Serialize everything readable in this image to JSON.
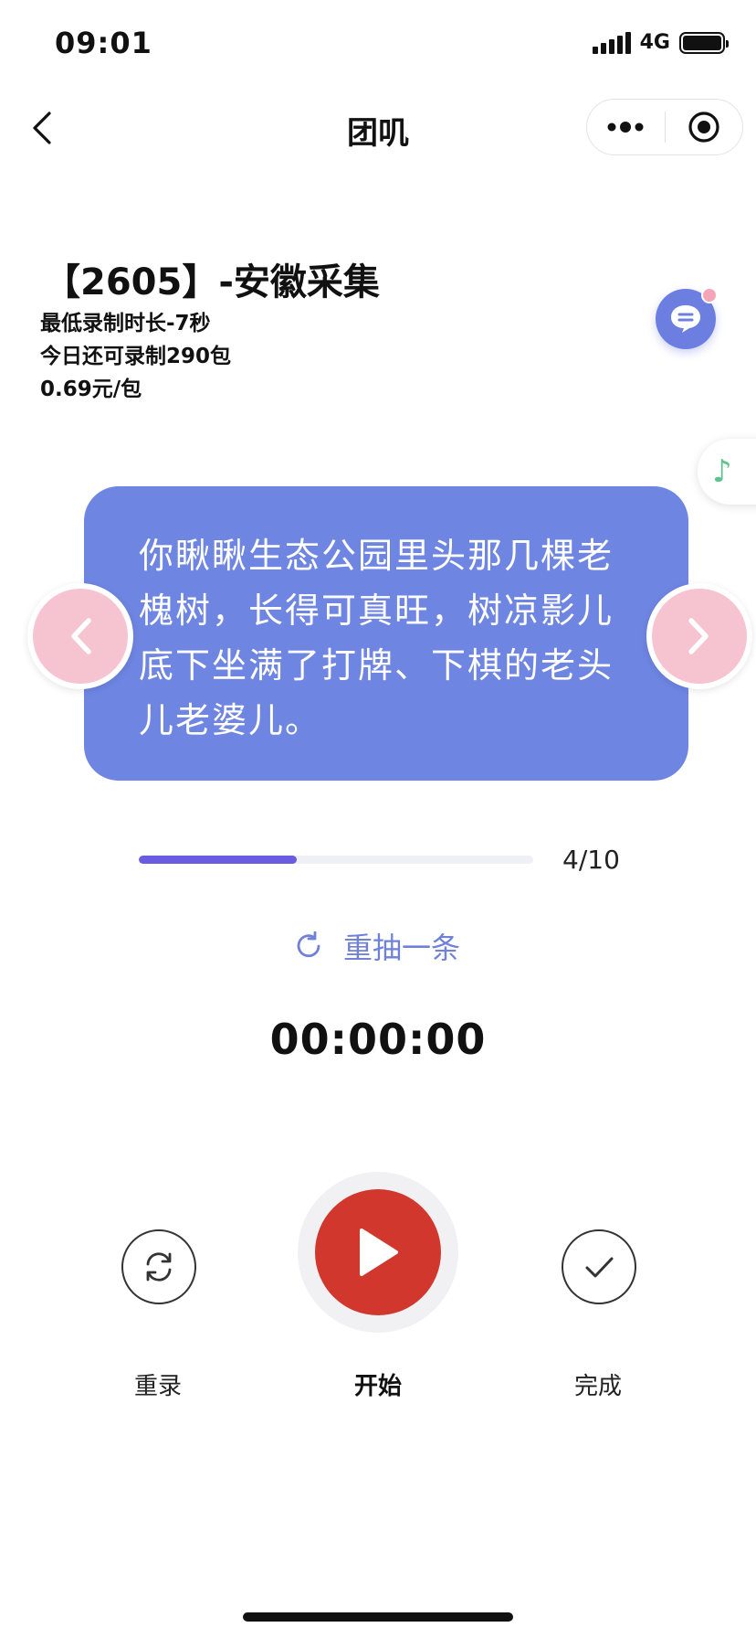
{
  "status_bar": {
    "time": "09:01",
    "network": "4G"
  },
  "nav": {
    "title": "团叽",
    "back_icon": "chevron-left-icon",
    "more_icon": "more-dots-icon",
    "close_icon": "target-circle-icon"
  },
  "task": {
    "title": "【2605】-安徽采集",
    "min_duration": "最低录制时长-7秒",
    "remaining_today": "今日还可录制290包",
    "price": "0.69元/包"
  },
  "floating": {
    "chat_icon": "chat-bubble-icon",
    "music_icon": "music-note-icon",
    "chat_color": "#6c7fe0",
    "music_color": "#5cc48a"
  },
  "prompt": {
    "text": "你瞅瞅生态公园里头那几棵老槐树，长得可真旺，树凉影儿底下坐满了打牌、下棋的老头儿老婆儿。",
    "card_color": "#6e85e2"
  },
  "progress": {
    "label": "4/10",
    "fraction": 0.4,
    "color": "#6a5ce0"
  },
  "redraw": {
    "label": "重抽一条",
    "icon": "refresh-icon"
  },
  "timer": "00:00:00",
  "controls": {
    "rerecord_label": "重录",
    "start_label": "开始",
    "done_label": "完成",
    "play_color": "#d2372e"
  }
}
